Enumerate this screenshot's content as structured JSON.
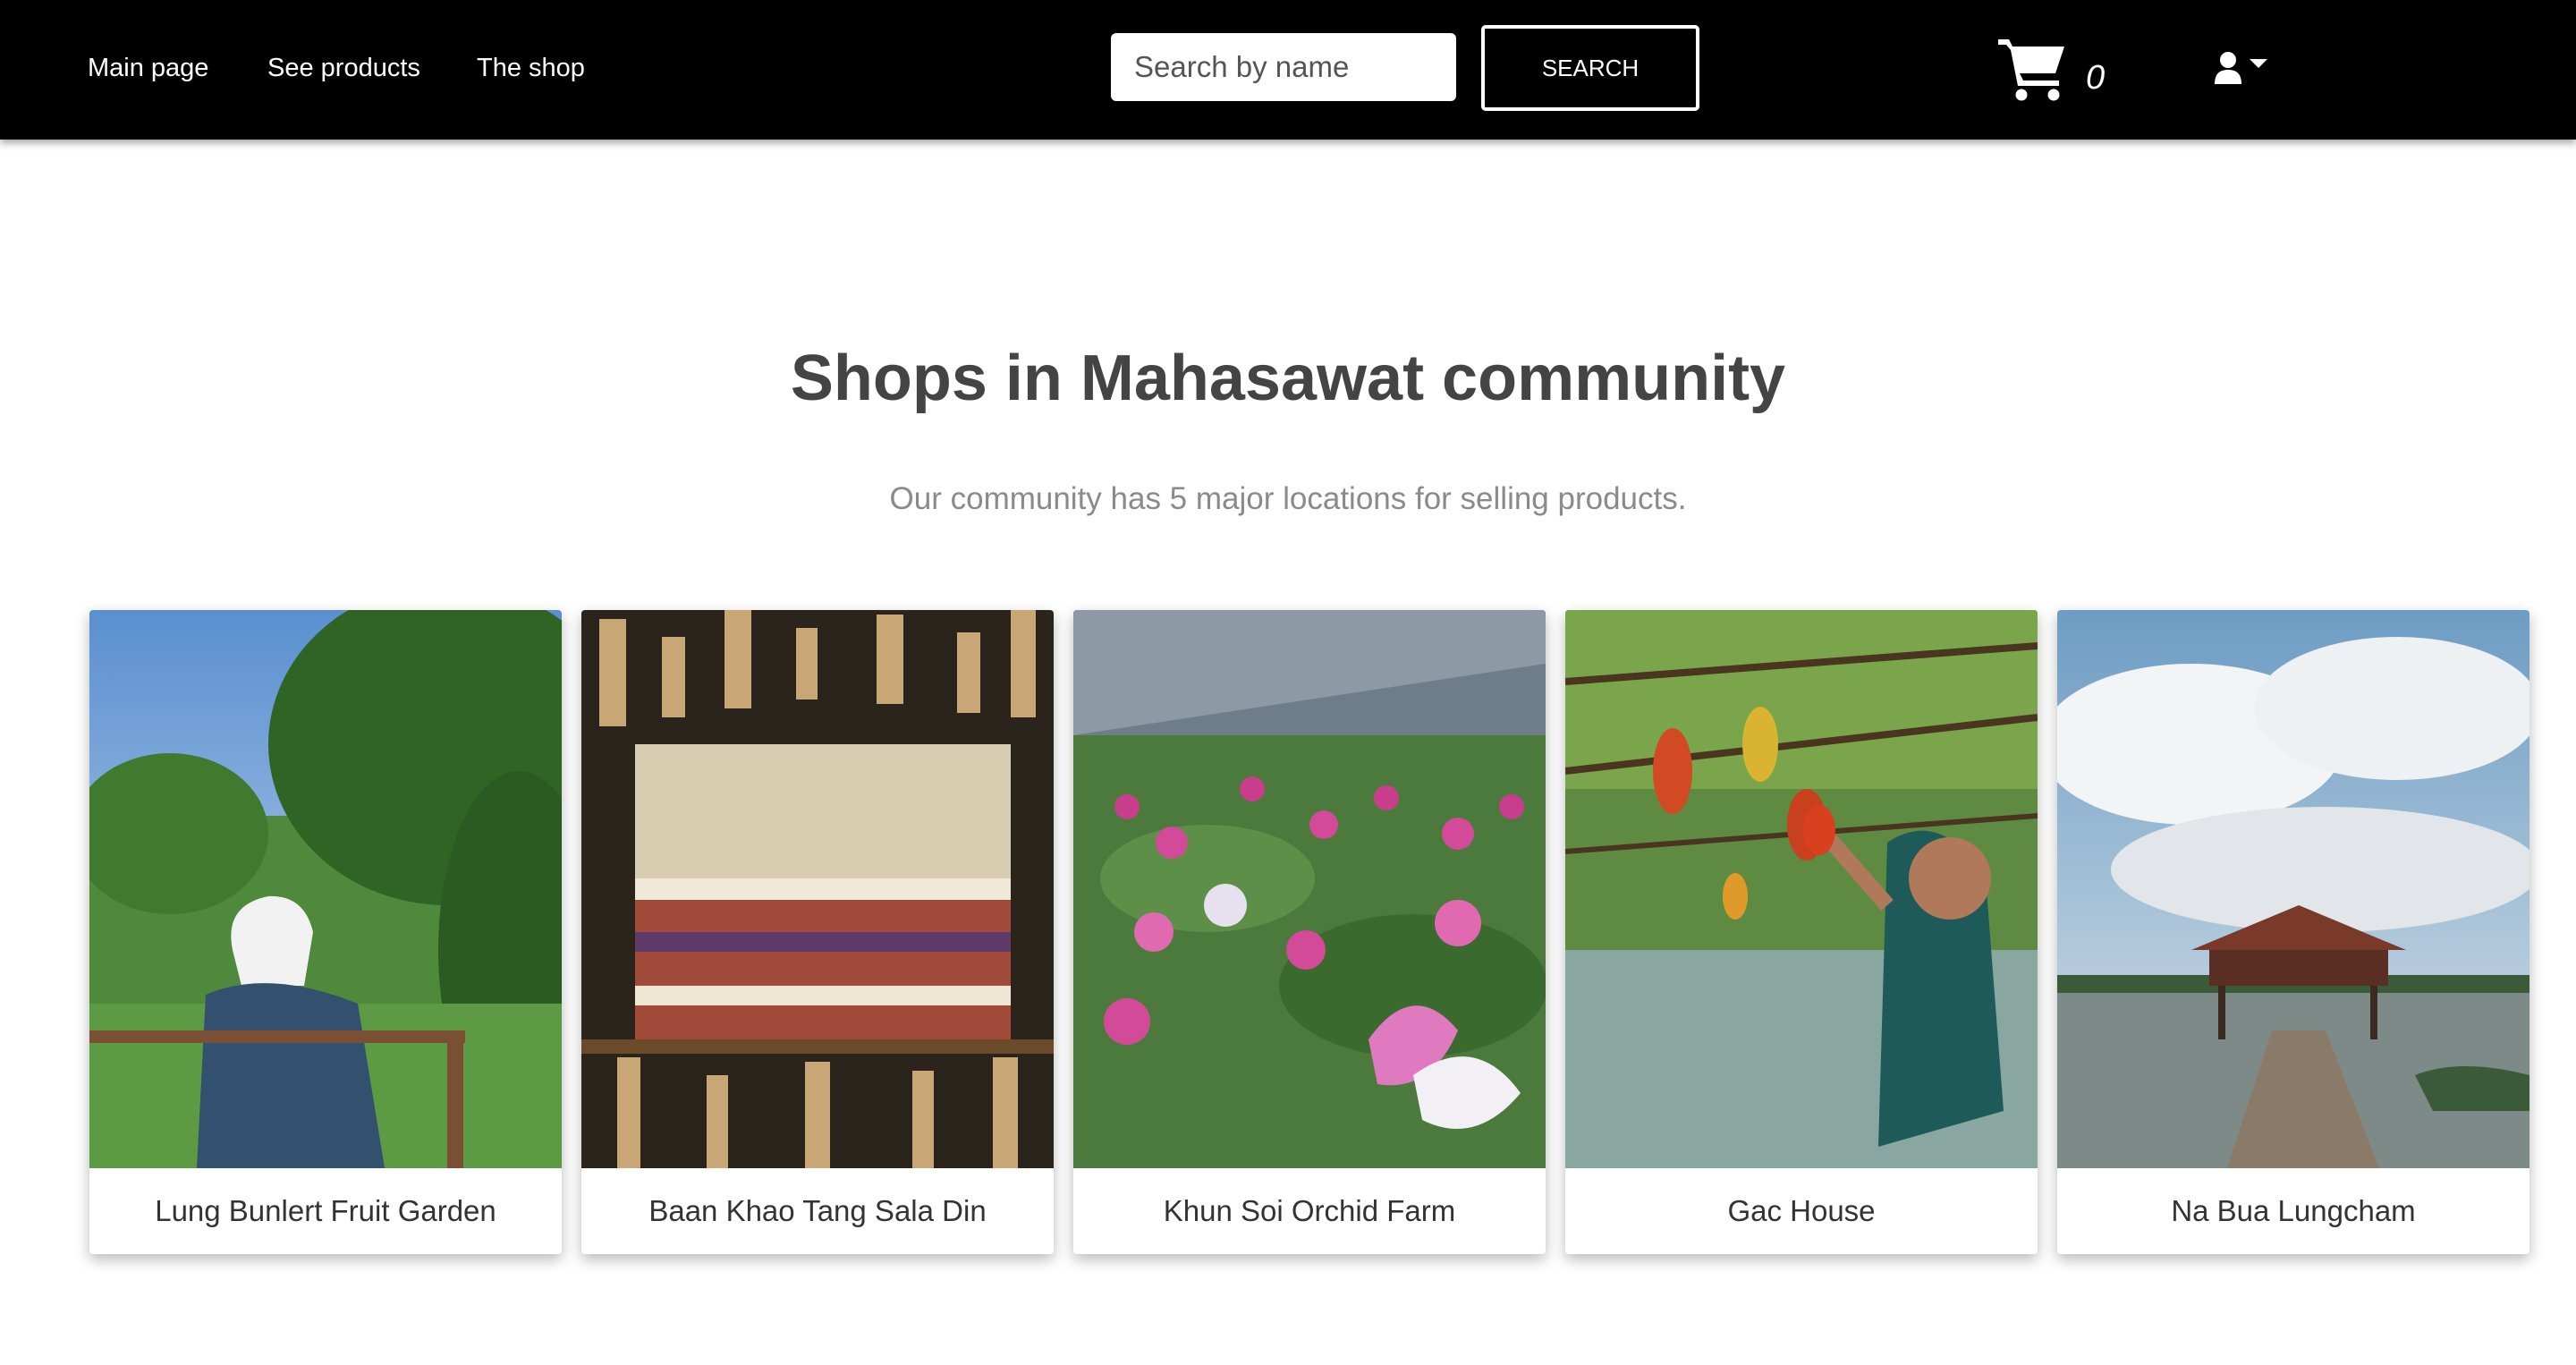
{
  "nav": {
    "links": [
      {
        "label": "Main page"
      },
      {
        "label": "See products"
      },
      {
        "label": "The shop"
      }
    ],
    "search": {
      "placeholder": "Search by name",
      "value": "",
      "button_label": "SEARCH"
    },
    "cart": {
      "count": "0",
      "icon": "cart-icon"
    },
    "user": {
      "icon": "user-icon"
    }
  },
  "main": {
    "title": "Shops in Mahasawat community",
    "subtitle": "Our community has 5 major locations for selling products."
  },
  "shops": [
    {
      "name": "Lung Bunlert Fruit Garden"
    },
    {
      "name": "Baan Khao Tang Sala Din"
    },
    {
      "name": "Khun Soi Orchid Farm"
    },
    {
      "name": "Gac House"
    },
    {
      "name": "Na Bua Lungcham"
    }
  ],
  "colors": {
    "navbar": "#000000",
    "title": "#444444",
    "subtitle": "#8a8a8a"
  }
}
